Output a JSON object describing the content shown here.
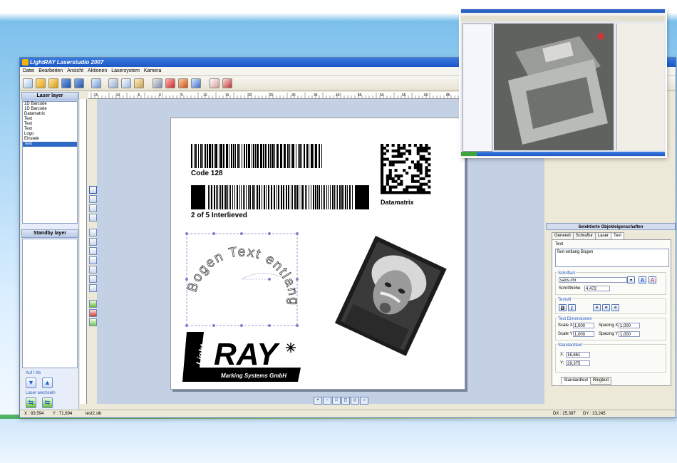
{
  "app": {
    "title": "LightRAY Laserstudio 2007",
    "menu": [
      "Datei",
      "Bearbeiten",
      "Ansicht",
      "Aktionen",
      "Lasersystem",
      "Kamera"
    ]
  },
  "left_panel": {
    "laser_layer_title": "Laser layer",
    "laser_items": [
      "1D Barcode",
      "1D Barcode",
      "Datamatrix",
      "Text",
      "Text",
      "Text",
      "Logo",
      "Einstein",
      "Text"
    ],
    "selected_index": 8,
    "standby_layer_title": "Standby layer",
    "auf_ab_label": "Auf / Ab",
    "laser_wechseln_label": "Laser wechseln"
  },
  "canvas": {
    "barcode1_caption": "Code 128",
    "barcode2_caption": "2 of 5 Interlieved",
    "datamatrix_caption": "Datamatrix",
    "arc_text": "Bogen Text entlang",
    "logo_light": "Light",
    "logo_ray": "RAY",
    "logo_sub": "Marking Systems GmbH"
  },
  "ruler_labels": [
    "-15",
    "-10",
    "-5",
    "0",
    "5",
    "10",
    "15",
    "20",
    "25",
    "30",
    "35",
    "40",
    "45",
    "50",
    "55",
    "60",
    "65"
  ],
  "properties": {
    "title": "Selektierte Objekteigenschaften",
    "tabs": [
      "Generell",
      "Schraffur",
      "Laser",
      "Text"
    ],
    "active_tab": "Text",
    "text_label": "Text",
    "text_value": "Text entlang Bogen",
    "schriftart_label": "Schriftart",
    "font_value": "sans.chr",
    "schrifthoehe_label": "Schrifthöhe",
    "schrifthoehe_value": "4,472",
    "textstil_label": "Textstil",
    "bold_label": "B",
    "italic_label": "I",
    "dimensionen_label": "Text Dimensionen",
    "scale_x_label": "Scale X",
    "scale_x_value": "1,000",
    "spacing_x_label": "Spacing X",
    "spacing_x_value": "1,000",
    "scale_y_label": "Scale Y",
    "scale_y_value": "1,000",
    "spacing_y_label": "Spacing Y",
    "spacing_y_value": "1,000",
    "standardtext_label": "Standardtext",
    "x_label": "X:",
    "x_value": "16,661",
    "y_label": "Y:",
    "y_value": "29,375",
    "bottom_tabs": [
      "Standardtext",
      "Ringtext"
    ]
  },
  "status": {
    "x": "X : 83,594",
    "y": "Y : 71,894",
    "file": "test2.slb",
    "dx": "DX : 25,387",
    "dy": "DY : 23,245"
  },
  "colors": {
    "accent": "#316ac5",
    "titlebar": "#1b56c6",
    "canvas_bg": "#c4d0e4",
    "handles": "#8a7ac8"
  }
}
